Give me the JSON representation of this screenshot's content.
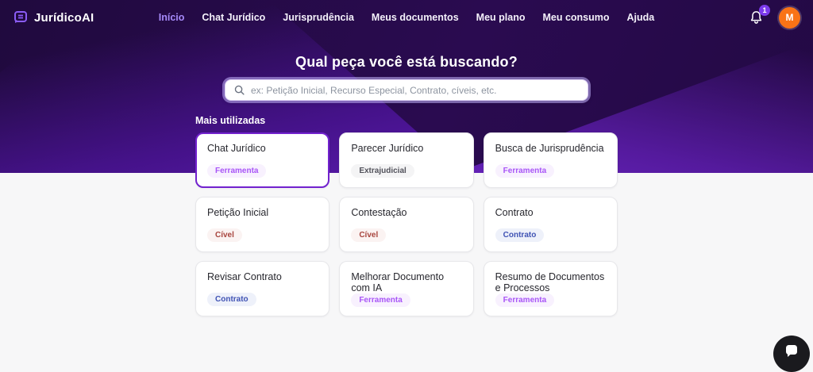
{
  "brand": {
    "name": "JurídicoAI"
  },
  "nav": {
    "items": [
      {
        "label": "Início",
        "active": true
      },
      {
        "label": "Chat Jurídico",
        "active": false
      },
      {
        "label": "Jurisprudência",
        "active": false
      },
      {
        "label": "Meus documentos",
        "active": false
      },
      {
        "label": "Meu plano",
        "active": false
      },
      {
        "label": "Meu consumo",
        "active": false
      },
      {
        "label": "Ajuda",
        "active": false
      }
    ]
  },
  "header": {
    "notification_count": "1",
    "avatar_initial": "M"
  },
  "hero": {
    "title": "Qual peça você está buscando?",
    "search_placeholder": "ex: Petição Inicial, Recurso Especial, Contrato, cíveis, etc."
  },
  "section": {
    "label": "Mais utilizadas"
  },
  "cards": [
    {
      "title": "Chat Jurídico",
      "badge": "Ferramenta",
      "badge_type": "tool",
      "selected": true
    },
    {
      "title": "Parecer Jurídico",
      "badge": "Extrajudicial",
      "badge_type": "neutral",
      "selected": false
    },
    {
      "title": "Busca de Jurisprudência",
      "badge": "Ferramenta",
      "badge_type": "tool",
      "selected": false
    },
    {
      "title": "Petição Inicial",
      "badge": "Cível",
      "badge_type": "civil",
      "selected": false
    },
    {
      "title": "Contestação",
      "badge": "Cível",
      "badge_type": "civil",
      "selected": false
    },
    {
      "title": "Contrato",
      "badge": "Contrato",
      "badge_type": "contract",
      "selected": false
    },
    {
      "title": "Revisar Contrato",
      "badge": "Contrato",
      "badge_type": "contract",
      "selected": false
    },
    {
      "title": "Melhorar Documento com IA",
      "badge": "Ferramenta",
      "badge_type": "tool",
      "selected": false
    },
    {
      "title": "Resumo de Documentos e Processos",
      "badge": "Ferramenta",
      "badge_type": "tool",
      "selected": false
    }
  ],
  "colors": {
    "header_bg": "#2a0b50",
    "accent": "#7c3aed",
    "nav_active": "#a78bfa",
    "avatar_bg": "#f97316",
    "selected_card_border": "#7222ce",
    "badge_tool_text": "#a855f7",
    "badge_tool_bg": "#f8f1fe",
    "badge_neutral_text": "#52525b",
    "badge_neutral_bg": "#f4f4f5",
    "badge_civil_text": "#a8453e",
    "badge_civil_bg": "#fbf3f2",
    "badge_contract_text": "#4053b4",
    "badge_contract_bg": "#eef1fa"
  }
}
